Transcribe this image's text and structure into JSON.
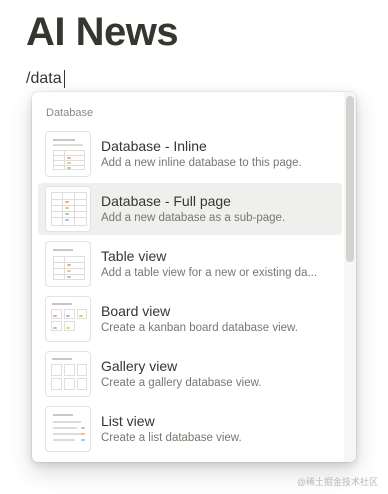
{
  "page": {
    "title": "AI News",
    "command_text": "/data"
  },
  "menu": {
    "section_label": "Database",
    "items": [
      {
        "title": "Database - Inline",
        "description": "Add a new inline database to this page.",
        "icon": "database-inline-icon",
        "selected": false
      },
      {
        "title": "Database - Full page",
        "description": "Add a new database as a sub-page.",
        "icon": "database-full-page-icon",
        "selected": true
      },
      {
        "title": "Table view",
        "description": "Add a table view for a new or existing da...",
        "icon": "table-view-icon",
        "selected": false
      },
      {
        "title": "Board view",
        "description": "Create a kanban board database view.",
        "icon": "board-view-icon",
        "selected": false
      },
      {
        "title": "Gallery view",
        "description": "Create a gallery database view.",
        "icon": "gallery-view-icon",
        "selected": false
      },
      {
        "title": "List view",
        "description": "Create a list database view.",
        "icon": "list-view-icon",
        "selected": false
      }
    ]
  },
  "watermark": "@稀土掘金技术社区",
  "colors": {
    "text": "#37352f",
    "muted": "#78776f",
    "selected_bg": "#efefee",
    "tag_red": "#e8a8a3",
    "tag_orange": "#f1c27d",
    "tag_green": "#9fd4a9",
    "tag_blue": "#9cc3e8",
    "tag_yellow": "#f3d36b"
  }
}
